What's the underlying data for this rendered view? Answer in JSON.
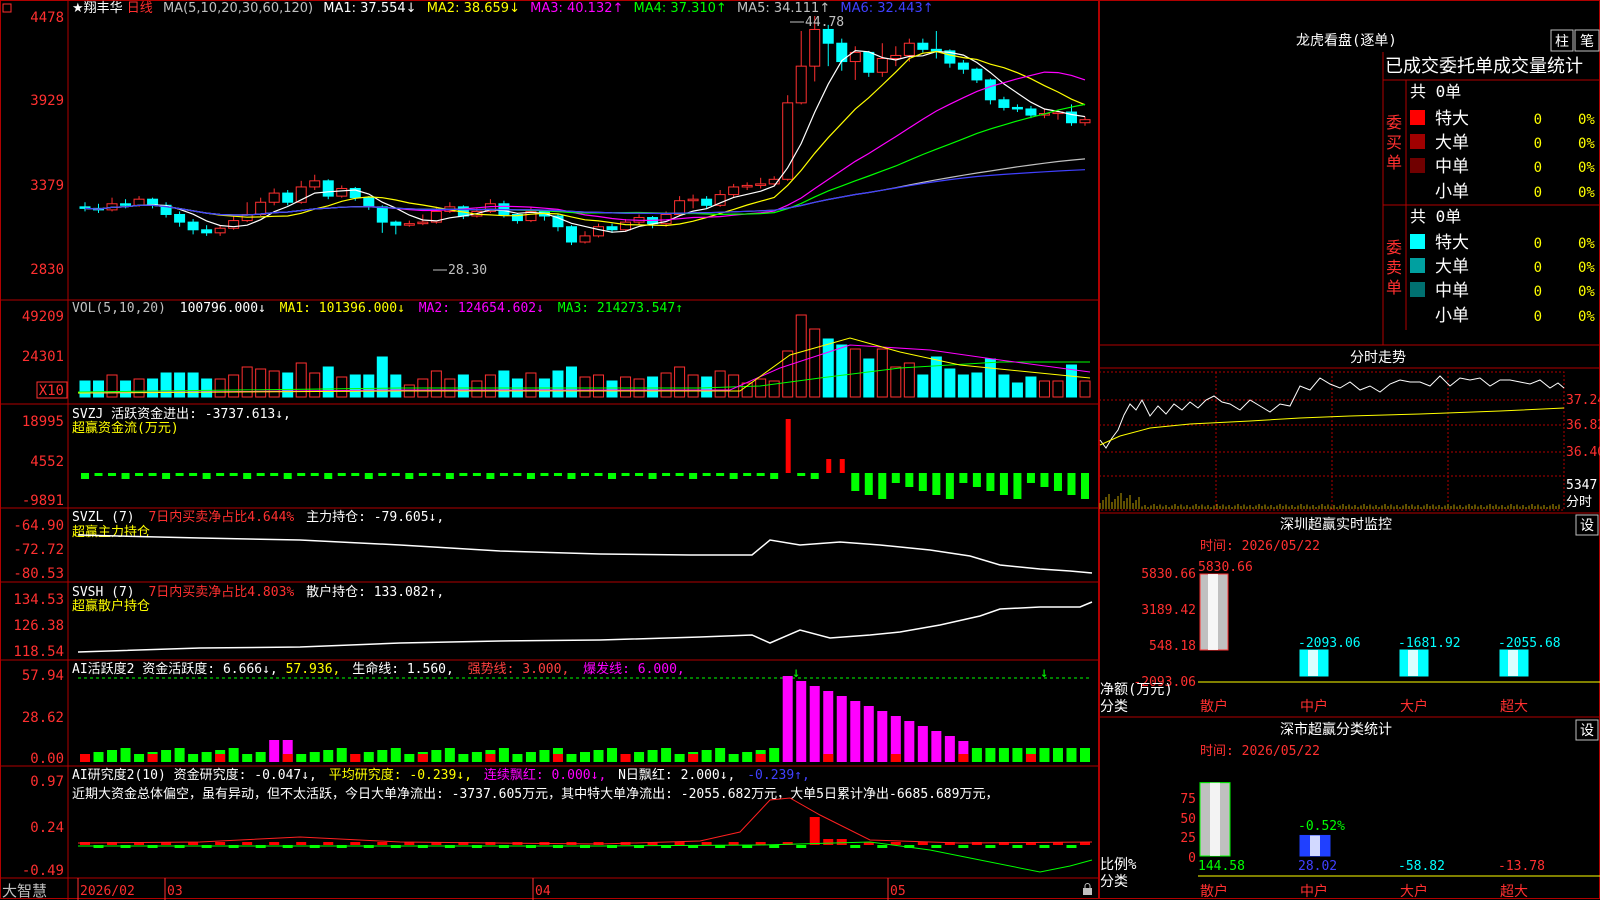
{
  "stock": {
    "name": "★翔丰华",
    "period": "日线"
  },
  "axes": {
    "price_ticks": [
      "4478",
      "3929",
      "3379",
      "2830"
    ],
    "vol_ticks": [
      "49209",
      "24301"
    ],
    "vol_scale": "X10",
    "zj_ticks": [
      "18995",
      "4552",
      "-9891"
    ],
    "zl_ticks": [
      "-64.90",
      "-72.72",
      "-80.53"
    ],
    "sh_ticks": [
      "134.53",
      "126.38",
      "118.54"
    ],
    "hy_ticks": [
      "57.94",
      "28.62",
      "0.00"
    ],
    "yj_ticks": [
      "0.97",
      "0.24",
      "-0.49"
    ]
  },
  "ma_line": {
    "label": "MA(5,10,20,30,60,120)",
    "items": [
      {
        "text": "MA1: 37.554↓",
        "color": "#ffffff"
      },
      {
        "text": "MA2: 38.659↓",
        "color": "#ffff00"
      },
      {
        "text": "MA3: 40.132↑",
        "color": "#ff00ff"
      },
      {
        "text": "MA4: 37.310↑",
        "color": "#00ff00"
      },
      {
        "text": "MA5: 34.111↑",
        "color": "#c0c0c0"
      },
      {
        "text": "MA6: 32.443↑",
        "color": "#0000ff"
      }
    ],
    "high_label": "44.78",
    "low_label": "28.30"
  },
  "vol_line": {
    "label": "VOL(5,10,20)",
    "items": [
      {
        "text": "100796.000↓",
        "color": "#ffffff"
      },
      {
        "text": "MA1: 101396.000↓",
        "color": "#ffff00"
      },
      {
        "text": "MA2: 124654.602↓",
        "color": "#ff00ff"
      },
      {
        "text": "MA3: 214273.547↑",
        "color": "#00ff00"
      }
    ]
  },
  "svzj": {
    "l1": "SVZJ  活跃资金进出: -3737.613↓,",
    "l2": "超赢资金流(万元)"
  },
  "svzl": {
    "a": "SVZL (7)",
    "b": "7日内买卖净占比4.644%",
    "c": "主力持仓: -79.605↓,",
    "l2": "超赢主力持仓"
  },
  "svsh": {
    "a": "SVSH (7)",
    "b": "7日内买卖净占比4.803%",
    "c": "散户持仓: 133.082↑,",
    "l2": "超赢散户持仓"
  },
  "hy": {
    "items": [
      {
        "text": "AI活跃度2 资金活跃度: 6.666↓,",
        "color": "#ffffff"
      },
      {
        "text": "57.936,",
        "color": "#ffff00"
      },
      {
        "text": "生命线: 1.560,",
        "color": "#ffffff"
      },
      {
        "text": "强势线: 3.000,",
        "color": "#ff4040"
      },
      {
        "text": "爆发线: 6.000,",
        "color": "#ff00ff"
      }
    ]
  },
  "yj": {
    "items": [
      {
        "text": "AI研究度2(10) 资金研究度: -0.047↓,",
        "color": "#ffffff"
      },
      {
        "text": "平均研究度: -0.239↓,",
        "color": "#ffff00"
      },
      {
        "text": "连续飘红: 0.000↓,",
        "color": "#ff00ff"
      },
      {
        "text": "N日飘红: 2.000↓,",
        "color": "#ffffff"
      },
      {
        "text": "-0.239↑,",
        "color": "#4040ff"
      }
    ],
    "comment": "近期大资金总体偏空，虽有异动，但不太活跃，今日大单净流出: -3737.605万元，其中特大单净流出: -2055.682万元，大单5日累计净出-6685.689万元，"
  },
  "timeline": {
    "app": "大智慧",
    "labels": [
      "2026/02",
      "03",
      "04",
      "05"
    ]
  },
  "right": {
    "lhb": {
      "title": "龙虎看盘(逐单)",
      "btn1": "柱",
      "btn2": "笔",
      "subtitle": "已成交委托单成交量统计",
      "buy": {
        "label": [
          "委",
          "买",
          "单"
        ],
        "total": "共 0单",
        "rows": [
          {
            "name": "特大",
            "qty": "0",
            "pct": "0%",
            "color": "#ff0000"
          },
          {
            "name": "大单",
            "qty": "0",
            "pct": "0%",
            "color": "#a00000"
          },
          {
            "name": "中单",
            "qty": "0",
            "pct": "0%",
            "color": "#700000"
          },
          {
            "name": "小单",
            "qty": "0",
            "pct": "0%",
            "color": "#000000"
          }
        ]
      },
      "sell": {
        "label": [
          "委",
          "卖",
          "单"
        ],
        "total": "共 0单",
        "rows": [
          {
            "name": "特大",
            "qty": "0",
            "pct": "0%",
            "color": "#00ffff"
          },
          {
            "name": "大单",
            "qty": "0",
            "pct": "0%",
            "color": "#00a0a0"
          },
          {
            "name": "中单",
            "qty": "0",
            "pct": "0%",
            "color": "#007070"
          },
          {
            "name": "小单",
            "qty": "0",
            "pct": "0%",
            "color": "#000000"
          }
        ]
      }
    },
    "fs": {
      "title": "分时走势",
      "ticks": [
        "37.24",
        "36.82",
        "36.40"
      ],
      "vol": "5347",
      "vol_label": "分时"
    },
    "monitor": {
      "title": "深圳超赢实时监控",
      "btn": "设",
      "time": "时间: 2026/05/22",
      "y_ticks": [
        "5830.66",
        "3189.42",
        "548.18",
        "-2093.06"
      ],
      "unit": "净额(万元)",
      "cat_label": "分类",
      "categories": [
        "散户",
        "中户",
        "大户",
        "超大"
      ],
      "values": [
        5830.66,
        -2093.06,
        -1681.92,
        -2055.68
      ],
      "value_labels": [
        "5830.66",
        "-2093.06",
        "-1681.92",
        "-2055.68"
      ]
    },
    "stats": {
      "title": "深市超赢分类统计",
      "btn": "设",
      "time": "时间: 2026/05/22",
      "y_ticks": [
        "75",
        "50",
        "25",
        "0"
      ],
      "unit": "比例%",
      "cat_label": "分类",
      "categories": [
        "散户",
        "中户",
        "大户",
        "超大"
      ],
      "values": [
        144.58,
        28.02,
        -58.82,
        -13.78
      ],
      "value_labels": [
        "144.58",
        "28.02",
        "-58.82",
        "-13.78"
      ],
      "bar_label": "-0.52%"
    }
  },
  "chart_data": {
    "type": "candlestick",
    "candles": [
      [
        3230,
        3220,
        3260,
        3200
      ],
      [
        3220,
        3210,
        3250,
        3190
      ],
      [
        3210,
        3250,
        3290,
        3200
      ],
      [
        3250,
        3240,
        3280,
        3220
      ],
      [
        3240,
        3280,
        3300,
        3230
      ],
      [
        3280,
        3240,
        3290,
        3220
      ],
      [
        3240,
        3180,
        3260,
        3160
      ],
      [
        3180,
        3130,
        3200,
        3100
      ],
      [
        3130,
        3080,
        3150,
        3050
      ],
      [
        3080,
        3060,
        3110,
        3040
      ],
      [
        3060,
        3090,
        3110,
        3040
      ],
      [
        3090,
        3140,
        3170,
        3080
      ],
      [
        3140,
        3180,
        3260,
        3130
      ],
      [
        3180,
        3260,
        3290,
        3170
      ],
      [
        3260,
        3320,
        3350,
        3240
      ],
      [
        3320,
        3260,
        3340,
        3240
      ],
      [
        3260,
        3360,
        3400,
        3250
      ],
      [
        3360,
        3400,
        3440,
        3340
      ],
      [
        3400,
        3300,
        3410,
        3280
      ],
      [
        3300,
        3350,
        3370,
        3290
      ],
      [
        3350,
        3290,
        3360,
        3270
      ],
      [
        3290,
        3230,
        3300,
        3210
      ],
      [
        3230,
        3130,
        3240,
        3060
      ],
      [
        3130,
        3110,
        3140,
        3050
      ],
      [
        3110,
        3120,
        3140,
        3100
      ],
      [
        3120,
        3130,
        3180,
        3110
      ],
      [
        3130,
        3200,
        3230,
        3120
      ],
      [
        3200,
        3230,
        3260,
        3190
      ],
      [
        3230,
        3170,
        3240,
        3150
      ],
      [
        3170,
        3200,
        3220,
        3160
      ],
      [
        3200,
        3250,
        3280,
        3190
      ],
      [
        3250,
        3180,
        3270,
        3160
      ],
      [
        3180,
        3140,
        3190,
        3120
      ],
      [
        3140,
        3200,
        3230,
        3130
      ],
      [
        3200,
        3170,
        3210,
        3140
      ],
      [
        3170,
        3100,
        3180,
        3070
      ],
      [
        3100,
        3000,
        3110,
        2980
      ],
      [
        3000,
        3040,
        3070,
        2990
      ],
      [
        3040,
        3100,
        3120,
        3030
      ],
      [
        3100,
        3080,
        3120,
        3060
      ],
      [
        3080,
        3130,
        3150,
        3070
      ],
      [
        3130,
        3160,
        3180,
        3110
      ],
      [
        3160,
        3120,
        3170,
        3090
      ],
      [
        3120,
        3180,
        3200,
        3100
      ],
      [
        3180,
        3270,
        3300,
        3170
      ],
      [
        3270,
        3280,
        3310,
        3220
      ],
      [
        3280,
        3240,
        3300,
        3220
      ],
      [
        3240,
        3310,
        3340,
        3230
      ],
      [
        3310,
        3360,
        3380,
        3290
      ],
      [
        3360,
        3370,
        3390,
        3340
      ],
      [
        3370,
        3380,
        3420,
        3350
      ],
      [
        3380,
        3410,
        3430,
        3370
      ],
      [
        3410,
        3910,
        3960,
        3400
      ],
      [
        3910,
        4150,
        4380,
        3900
      ],
      [
        4150,
        4390,
        4478,
        4050
      ],
      [
        4390,
        4300,
        4420,
        4150
      ],
      [
        4300,
        4180,
        4330,
        4120
      ],
      [
        4180,
        4240,
        4280,
        4060
      ],
      [
        4240,
        4110,
        4250,
        4080
      ],
      [
        4110,
        4200,
        4300,
        4080
      ],
      [
        4200,
        4220,
        4280,
        4150
      ],
      [
        4220,
        4300,
        4330,
        4180
      ],
      [
        4300,
        4260,
        4330,
        4240
      ],
      [
        4260,
        4250,
        4380,
        4200
      ],
      [
        4250,
        4170,
        4260,
        4140
      ],
      [
        4170,
        4130,
        4190,
        4100
      ],
      [
        4130,
        4060,
        4140,
        4040
      ],
      [
        4060,
        3930,
        4070,
        3900
      ],
      [
        3930,
        3880,
        3950,
        3860
      ],
      [
        3880,
        3870,
        3900,
        3850
      ],
      [
        3870,
        3830,
        3890,
        3810
      ],
      [
        3830,
        3840,
        3870,
        3810
      ],
      [
        3840,
        3850,
        3860,
        3800
      ],
      [
        3850,
        3780,
        3900,
        3760
      ],
      [
        3780,
        3800,
        3820,
        3760
      ]
    ]
  }
}
